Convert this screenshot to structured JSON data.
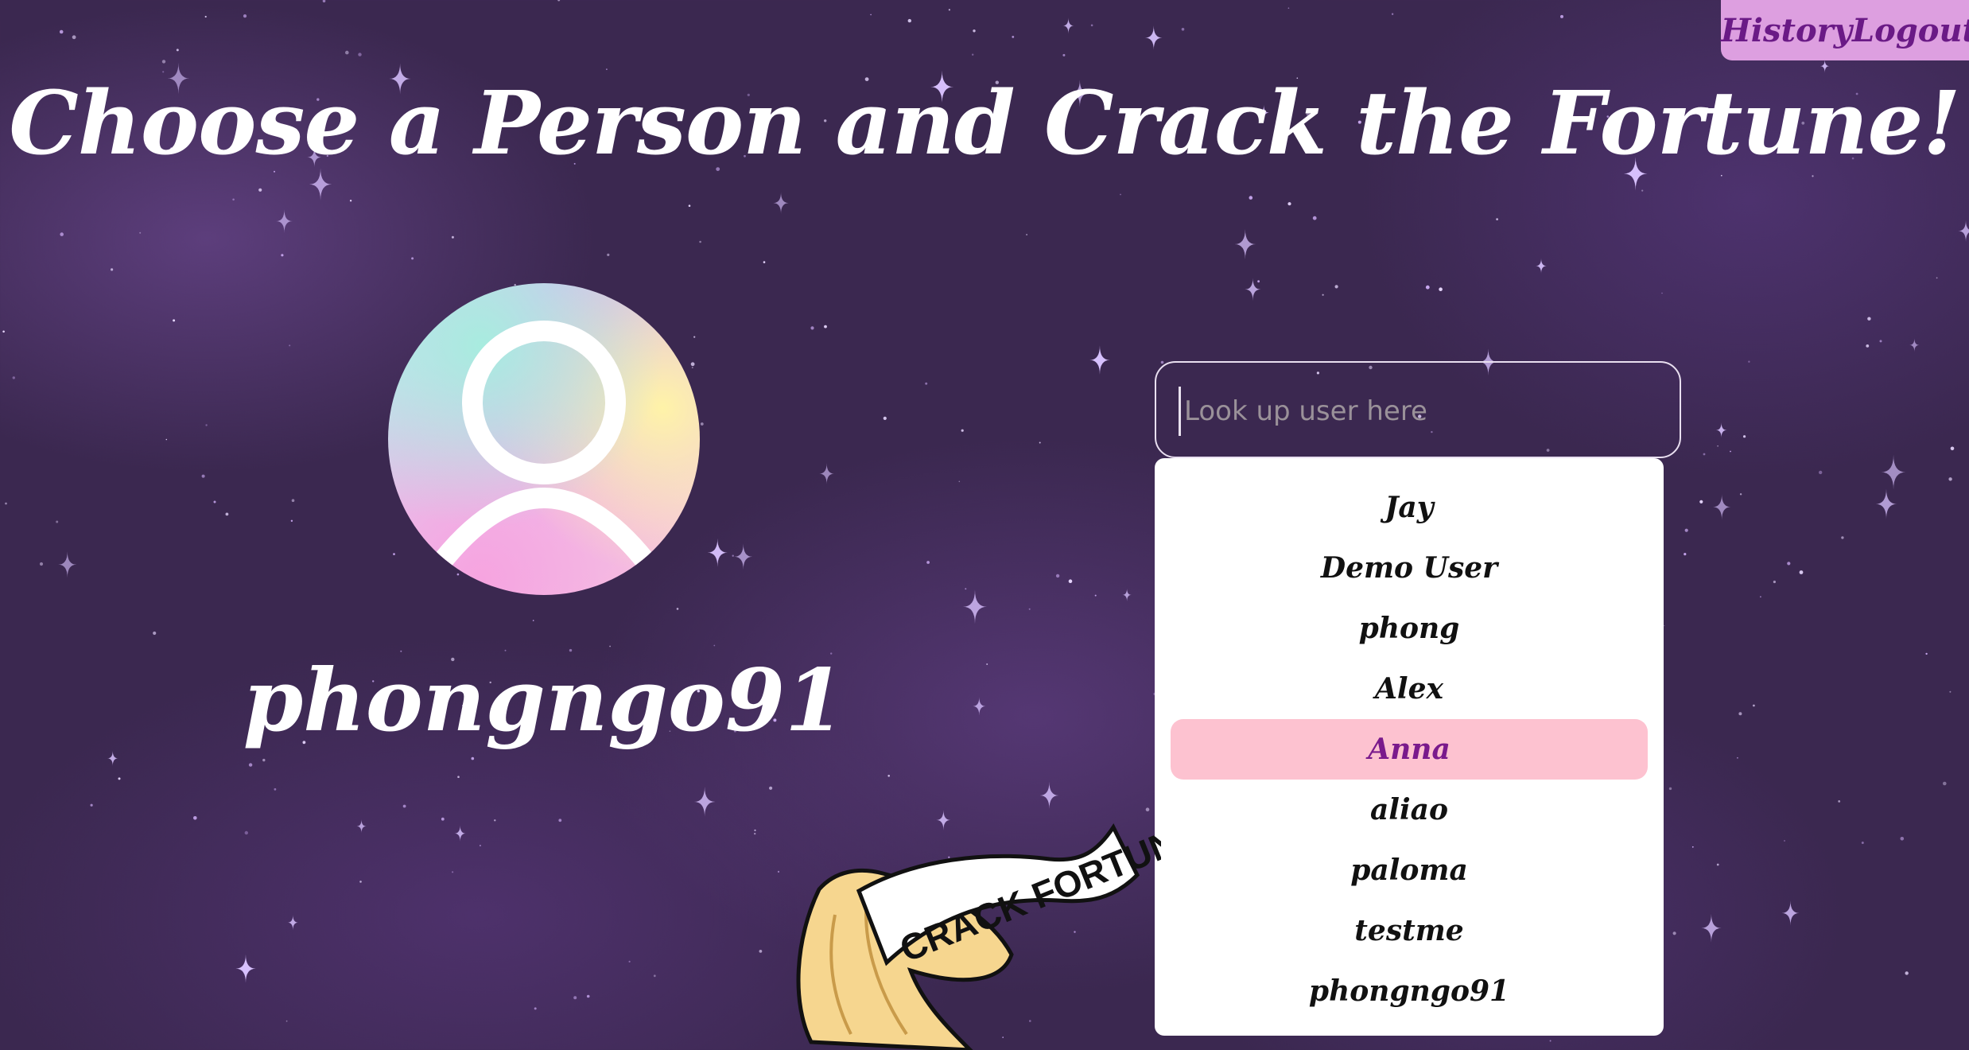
{
  "nav": {
    "history_label": "History",
    "logout_label": "Logout"
  },
  "page": {
    "title": "Choose a Person and Crack the Fortune!"
  },
  "profile": {
    "username": "phongngo91"
  },
  "search": {
    "placeholder": "Look up user here",
    "value": ""
  },
  "dropdown": {
    "items": [
      "Jay",
      "Demo User",
      "phong",
      "Alex",
      "Anna",
      "aliao",
      "paloma",
      "testme",
      "phongngo91"
    ],
    "highlighted": "Anna"
  },
  "logo": {
    "banner_text": "CRACK FORTUNE"
  },
  "colors": {
    "nav_bg": "#dd9fe0",
    "nav_text": "#6a1a86",
    "highlight_bg": "#fdc2d0",
    "highlight_text": "#7a1a8c",
    "background": "#3b2850"
  }
}
